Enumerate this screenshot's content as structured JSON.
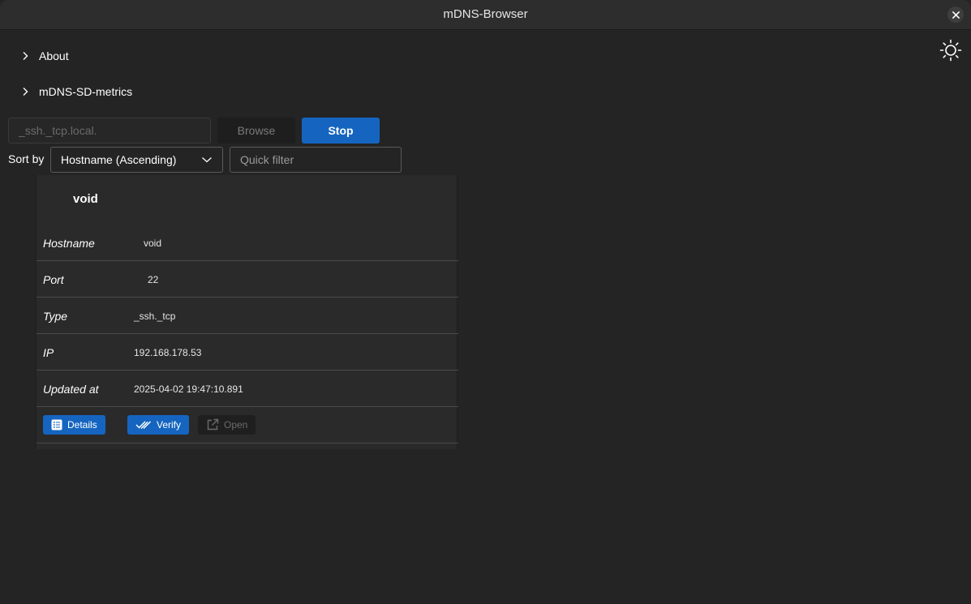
{
  "window": {
    "title": "mDNS-Browser"
  },
  "icons": {
    "close": "close-icon",
    "theme": "sun-icon",
    "chevron": "chevron-right-icon",
    "dropdown": "chevron-down-icon",
    "details": "list-icon",
    "verify": "double-check-icon",
    "open": "external-link-icon"
  },
  "colors": {
    "accent": "#1565c0",
    "background": "#242424",
    "card": "#2a2a2a"
  },
  "expanders": [
    {
      "label": "About"
    },
    {
      "label": "mDNS-SD-metrics"
    }
  ],
  "toolbar": {
    "service_placeholder": "_ssh._tcp.local.",
    "browse_label": "Browse",
    "stop_label": "Stop"
  },
  "sort": {
    "label": "Sort by",
    "selected": "Hostname (Ascending)",
    "filter_placeholder": "Quick filter"
  },
  "service": {
    "name": "void",
    "fields": [
      {
        "key": "Hostname",
        "value": "void"
      },
      {
        "key": "Port",
        "value": "22"
      },
      {
        "key": "Type",
        "value": "_ssh._tcp"
      },
      {
        "key": "IP",
        "value": "192.168.178.53"
      },
      {
        "key": "Updated at",
        "value": "2025-04-02 19:47:10.891"
      }
    ],
    "actions": {
      "details": "Details",
      "verify": "Verify",
      "open": "Open"
    }
  }
}
